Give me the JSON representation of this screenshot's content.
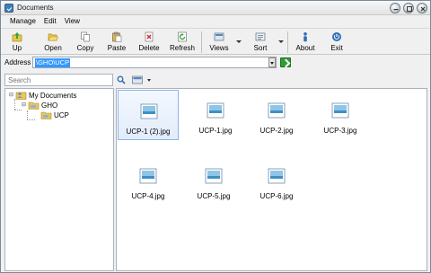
{
  "window": {
    "title": "Documents"
  },
  "menu": [
    "Manage",
    "Edit",
    "View"
  ],
  "toolbar": {
    "up": "Up",
    "open": "Open",
    "copy": "Copy",
    "paste": "Paste",
    "delete": "Delete",
    "refresh": "Refresh",
    "views": "Views",
    "sort": "Sort",
    "about": "About",
    "exit": "Exit"
  },
  "address": {
    "label": "Address",
    "value": "\\GHO\\UCP"
  },
  "search": {
    "placeholder": "Search"
  },
  "tree": [
    {
      "label": "My Documents",
      "expander": "⊟",
      "icon": "user-folder-icon"
    },
    {
      "label": "GHO",
      "expander": "⊟",
      "icon": "folder-icon"
    },
    {
      "label": "UCP",
      "expander": "",
      "icon": "folder-icon"
    }
  ],
  "files": [
    {
      "name": "UCP-1 (2).jpg",
      "selected": true
    },
    {
      "name": "UCP-1.jpg",
      "selected": false
    },
    {
      "name": "UCP-2.jpg",
      "selected": false
    },
    {
      "name": "UCP-3.jpg",
      "selected": false
    },
    {
      "name": "UCP-4.jpg",
      "selected": false
    },
    {
      "name": "UCP-5.jpg",
      "selected": false
    },
    {
      "name": "UCP-6.jpg",
      "selected": false
    }
  ],
  "colors": {
    "selection": "#3399ff",
    "go": "#2e9d33",
    "accent": "#3f7fb8"
  }
}
